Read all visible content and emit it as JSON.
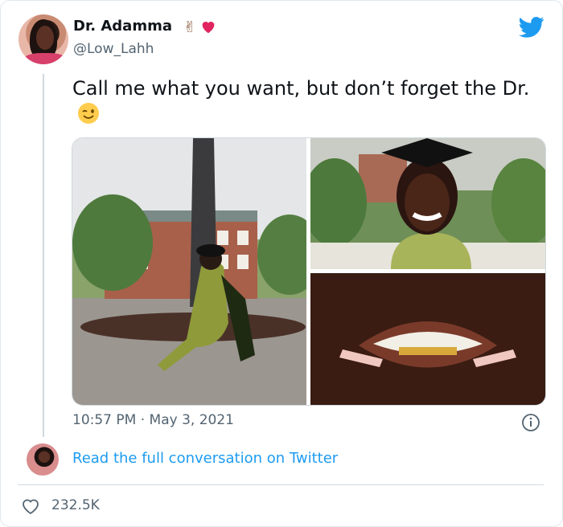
{
  "author": {
    "name": "Dr. Adamma",
    "handle": "@Low_Lahh",
    "name_emojis": [
      "victory-hand",
      "red-heart"
    ]
  },
  "tweet": {
    "text": "Call me what you want, but don’t forget the Dr.",
    "trailing_emoji": "winking-face",
    "images": [
      {
        "name": "graduate-seated-in-courtyard-photo"
      },
      {
        "name": "graduate-smiling-cap-photo"
      },
      {
        "name": "gold-grill-teeth-closeup-photo"
      }
    ],
    "timestamp": "10:57 PM · May 3, 2021"
  },
  "conversation": {
    "link_text": "Read the full conversation on Twitter"
  },
  "stats": {
    "likes": "232.5K"
  },
  "colors": {
    "link": "#1d9bf0",
    "twitter_blue": "#1d9bf0",
    "muted_text": "#536471",
    "heart_red": "#e0245e"
  }
}
